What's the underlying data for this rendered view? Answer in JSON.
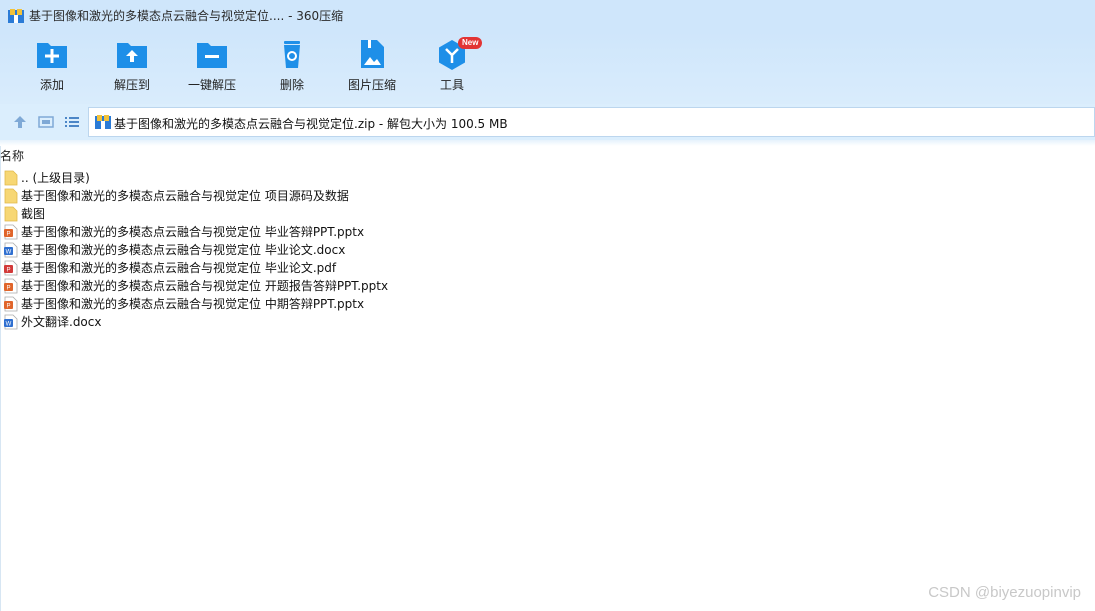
{
  "window": {
    "title": "基于图像和激光的多模态点云融合与视觉定位.... - 360压缩"
  },
  "toolbar": {
    "items": [
      {
        "label": "添加",
        "icon": "add-folder-icon"
      },
      {
        "label": "解压到",
        "icon": "extract-to-icon"
      },
      {
        "label": "一键解压",
        "icon": "one-click-extract-icon"
      },
      {
        "label": "删除",
        "icon": "delete-bin-icon"
      },
      {
        "label": "图片压缩",
        "icon": "image-compress-icon"
      },
      {
        "label": "工具",
        "icon": "tools-icon",
        "badge": "New"
      }
    ]
  },
  "addressbar": {
    "text": "基于图像和激光的多模态点云融合与视觉定位.zip - 解包大小为 100.5 MB"
  },
  "list": {
    "column_name": "名称",
    "items": [
      {
        "name": ".. (上级目录)",
        "type": "folder"
      },
      {
        "name": "基于图像和激光的多模态点云融合与视觉定位 项目源码及数据",
        "type": "folder"
      },
      {
        "name": "截图",
        "type": "folder"
      },
      {
        "name": "基于图像和激光的多模态点云融合与视觉定位 毕业答辩PPT.pptx",
        "type": "pptx"
      },
      {
        "name": "基于图像和激光的多模态点云融合与视觉定位 毕业论文.docx",
        "type": "docx"
      },
      {
        "name": "基于图像和激光的多模态点云融合与视觉定位 毕业论文.pdf",
        "type": "pdf"
      },
      {
        "name": "基于图像和激光的多模态点云融合与视觉定位 开题报告答辩PPT.pptx",
        "type": "pptx"
      },
      {
        "name": "基于图像和激光的多模态点云融合与视觉定位 中期答辩PPT.pptx",
        "type": "pptx"
      },
      {
        "name": "外文翻译.docx",
        "type": "docx"
      }
    ]
  },
  "watermark": "CSDN @biyezuopinvip",
  "colors": {
    "accent": "#1e8fe8",
    "titlebar": "#cfe6fb",
    "folder": "#f7d774",
    "pptx": "#e0652b",
    "docx": "#2f6fd0",
    "pdf": "#d23a3a",
    "badge": "#e23434"
  }
}
